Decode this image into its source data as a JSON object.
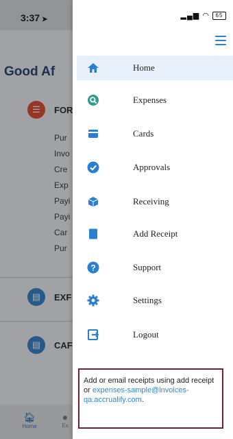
{
  "status_bar": {
    "time": "3:37",
    "battery": "65"
  },
  "background": {
    "greeting": "Good Af",
    "sections": [
      {
        "label": "FOR",
        "color": "#e0452c"
      },
      {
        "label": "EXF",
        "color": "#2f80c8"
      },
      {
        "label": "CAF",
        "color": "#2f80c8"
      }
    ],
    "sub_items": [
      "Pur",
      "Invo",
      "Cre",
      "Exp",
      "Payi",
      "Payi",
      "Car",
      "Pur"
    ],
    "bottom_nav": {
      "home_label": "Home",
      "second_label": "Ex"
    }
  },
  "menu": {
    "items": [
      {
        "label": "Home",
        "icon": "home-icon"
      },
      {
        "label": "Expenses",
        "icon": "expenses-search-icon"
      },
      {
        "label": "Cards",
        "icon": "card-icon"
      },
      {
        "label": "Approvals",
        "icon": "check-circle-icon"
      },
      {
        "label": "Receiving",
        "icon": "box-icon"
      },
      {
        "label": "Add Receipt",
        "icon": "receipt-icon"
      },
      {
        "label": "Support",
        "icon": "question-icon"
      },
      {
        "label": "Settings",
        "icon": "gear-icon"
      },
      {
        "label": "Logout",
        "icon": "logout-icon"
      }
    ],
    "active_index": 0,
    "accent_color": "#2a7fd1"
  },
  "notice": {
    "text_before": "Add or email receipts using add receipt or ",
    "email": "expenses-sample@invoices-qa.accrualify.com",
    "text_after": "."
  }
}
